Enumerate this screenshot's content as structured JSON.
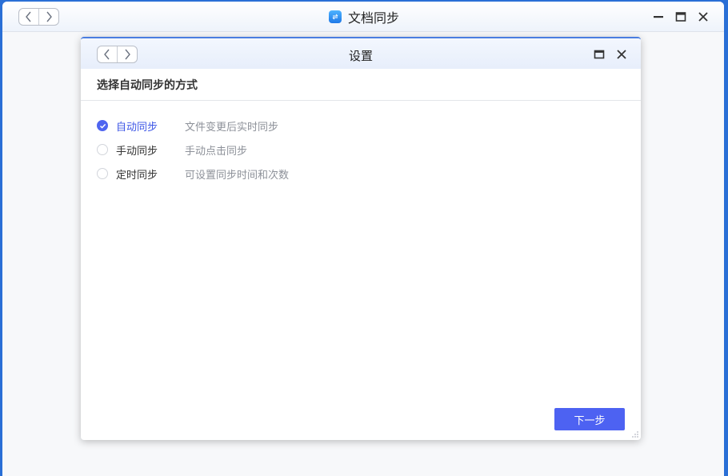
{
  "main_window": {
    "title": "文档同步",
    "nav": {
      "back_icon": "chevron-left-icon",
      "forward_icon": "chevron-right-icon"
    },
    "controls": [
      "minimize-icon",
      "maximize-icon",
      "close-icon"
    ]
  },
  "dialog": {
    "title": "设置",
    "section_title": "选择自动同步的方式",
    "options": [
      {
        "label": "自动同步",
        "description": "文件变更后实时同步",
        "selected": true
      },
      {
        "label": "手动同步",
        "description": "手动点击同步",
        "selected": false
      },
      {
        "label": "定时同步",
        "description": "可设置同步时间和次数",
        "selected": false
      }
    ],
    "next_label": "下一步"
  },
  "colors": {
    "accent": "#4d62f2",
    "desktop": "#2a6fd6",
    "selected_text": "#3e57e6"
  }
}
